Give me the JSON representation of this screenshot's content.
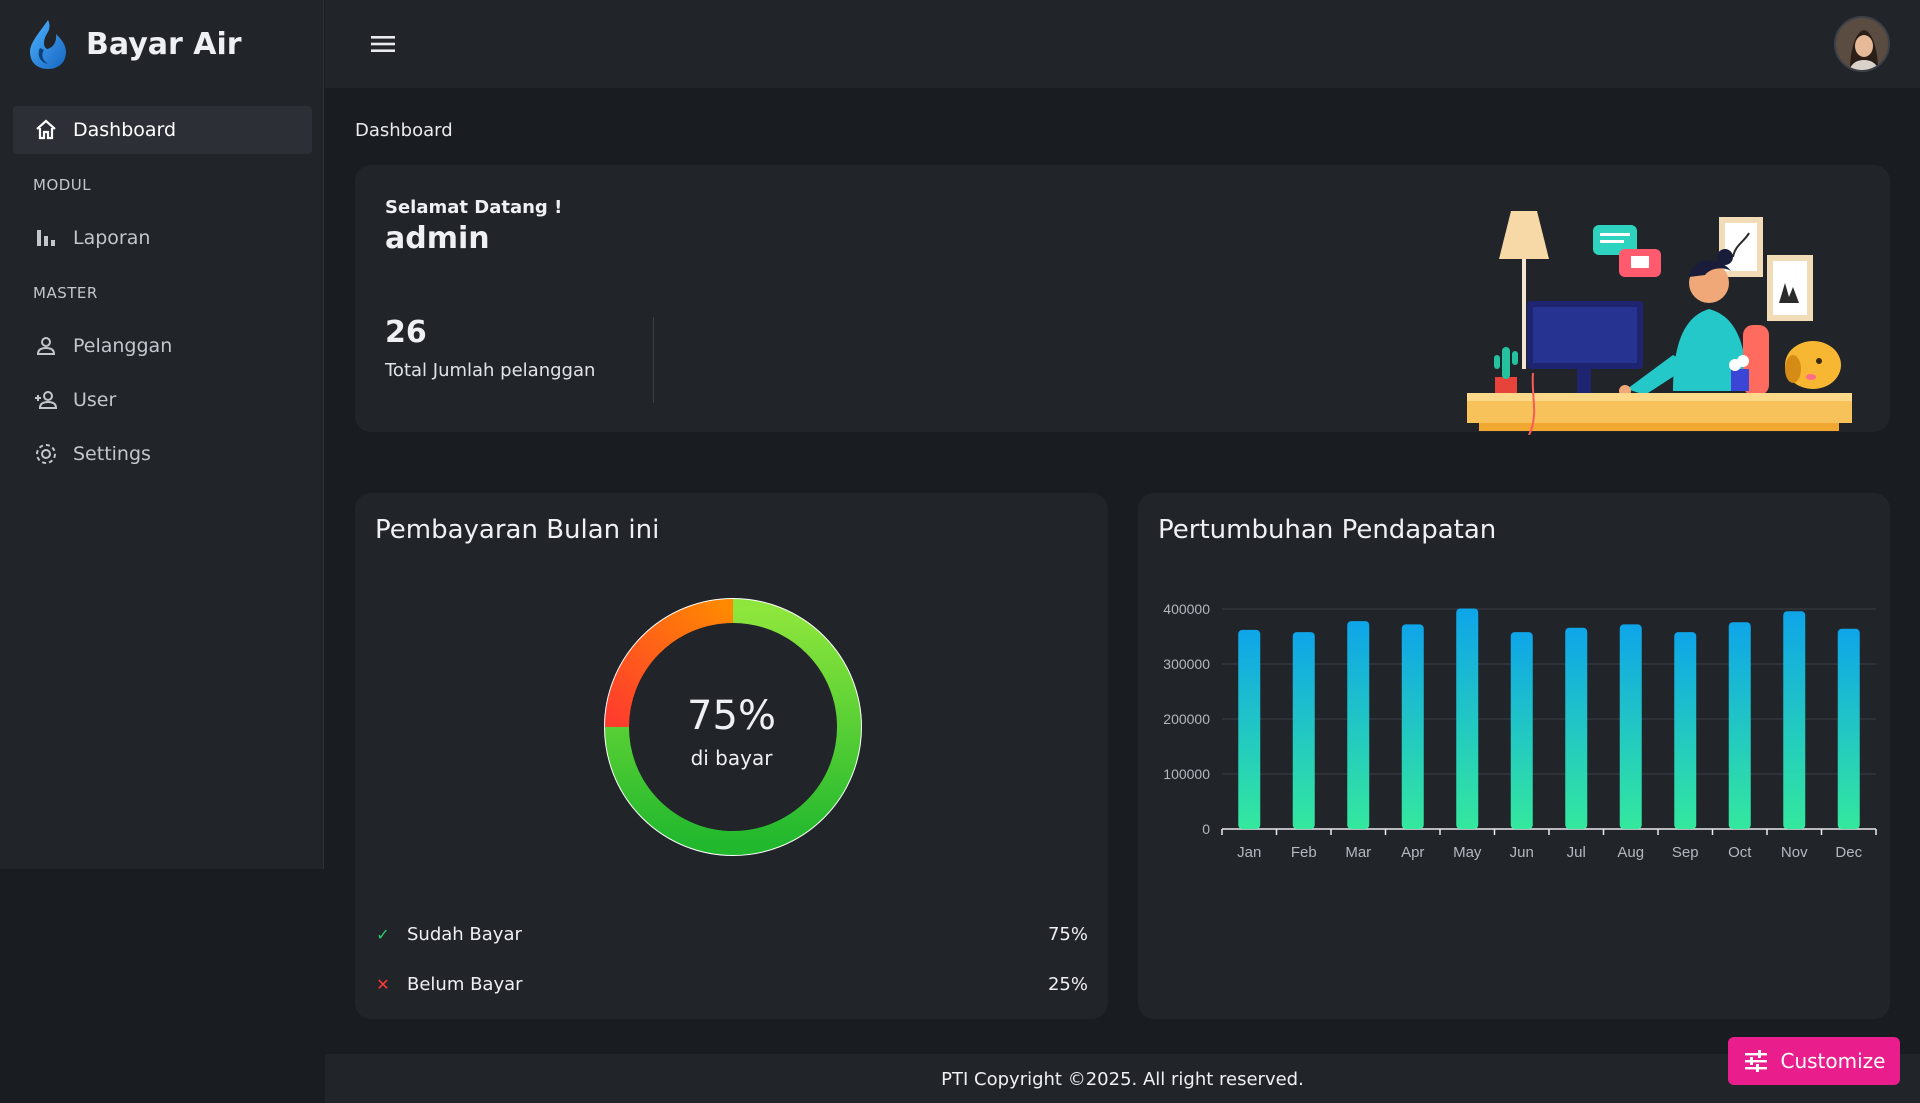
{
  "app": {
    "name": "Bayar Air"
  },
  "sidebar": {
    "dashboard": "Dashboard",
    "section_modul": "MODUL",
    "laporan": "Laporan",
    "section_master": "MASTER",
    "pelanggan": "Pelanggan",
    "user": "User",
    "settings": "Settings"
  },
  "breadcrumb": "Dashboard",
  "welcome": {
    "greeting": "Selamat Datang !",
    "username": "admin",
    "stat_value": "26",
    "stat_label": "Total Jumlah pelanggan"
  },
  "payment": {
    "title": "Pembayaran Bulan ini",
    "percent_label": "75%",
    "sub_label": "di bayar",
    "paid_fraction": 0.75,
    "legend": [
      {
        "label": "Sudah Bayar",
        "value": "75%",
        "mark": "✓",
        "color": "#2ecc71"
      },
      {
        "label": "Belum Bayar",
        "value": "25%",
        "mark": "✕",
        "color": "#ff3b3b"
      }
    ]
  },
  "growth": {
    "title": "Pertumbuhan Pendapatan"
  },
  "chart_data": {
    "type": "bar",
    "categories": [
      "Jan",
      "Feb",
      "Mar",
      "Apr",
      "May",
      "Jun",
      "Jul",
      "Aug",
      "Sep",
      "Oct",
      "Nov",
      "Dec"
    ],
    "values": [
      362000,
      358000,
      378000,
      372000,
      401000,
      358000,
      366000,
      372000,
      358000,
      376000,
      396000,
      364000
    ],
    "y_ticks": [
      "0",
      "100000",
      "200000",
      "300000",
      "400000"
    ],
    "ylim": [
      0,
      400000
    ],
    "grid": true
  },
  "footer": {
    "text": "PTI Copyright ©2025. All right reserved."
  },
  "customize": {
    "label": "Customize"
  },
  "colors": {
    "accent": "#e91e8c",
    "bar_top": "#0ea5e9",
    "bar_bottom": "#34e89e",
    "donut_green": "#3cc42a",
    "donut_orange": "#ff6a00"
  }
}
